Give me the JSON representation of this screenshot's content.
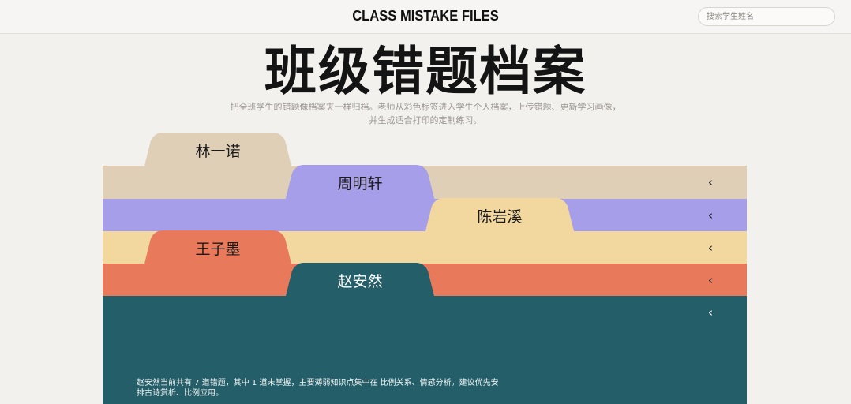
{
  "header": {
    "brand": "CLASS MISTAKE FILES",
    "search_placeholder": "搜索学生姓名"
  },
  "hero": {
    "title": "班级错题档案",
    "subtitle_line1": "把全班学生的错题像档案夹一样归档。老师从彩色标签进入学生个人档案，上传错题、更新学习画像，",
    "subtitle_line2": "并生成适合打印的定制练习。"
  },
  "folders": [
    {
      "name": "林一诺",
      "color": "#dfcfb7",
      "expanded": false
    },
    {
      "name": "周明轩",
      "color": "#a69ee8",
      "expanded": false
    },
    {
      "name": "陈岩溪",
      "color": "#f2d89e",
      "expanded": false
    },
    {
      "name": "王子墨",
      "color": "#e8795b",
      "expanded": false
    },
    {
      "name": "赵安然",
      "color": "#245e68",
      "expanded": true
    }
  ],
  "chevron_icon": "‹",
  "active_panel": {
    "summary": "赵安然当前共有 7 道错题，其中 1 道未掌握，主要薄弱知识点集中在 比例关系、情感分析。建议优先安排古诗赏析、比例应用。"
  }
}
